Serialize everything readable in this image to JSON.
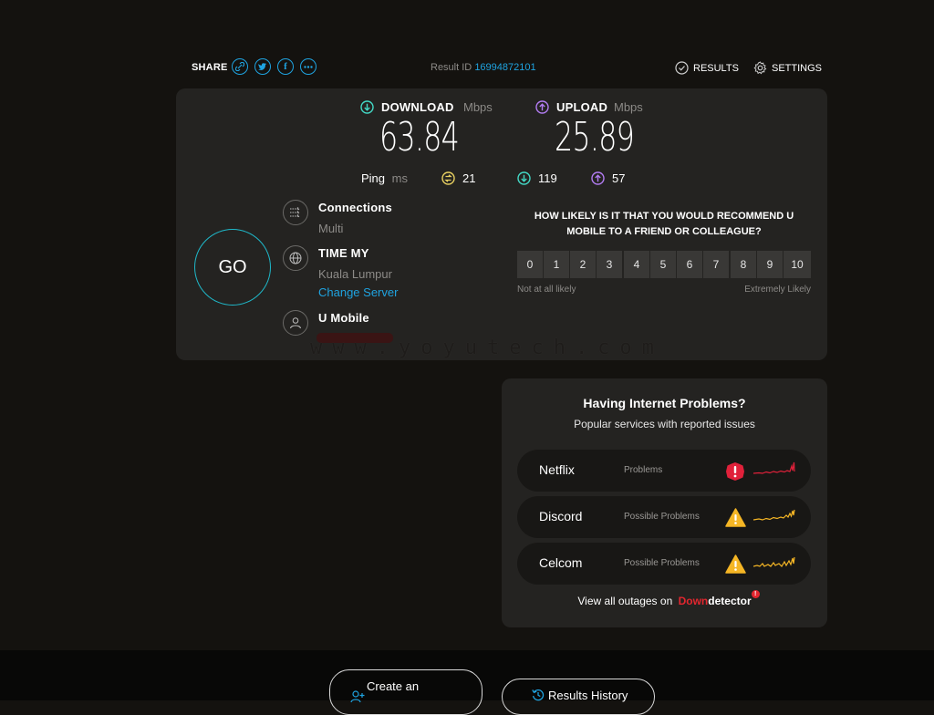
{
  "header": {
    "share_label": "SHARE",
    "share_icons": [
      "link-icon",
      "twitter-icon",
      "facebook-icon",
      "more-icon"
    ],
    "result_id_label": "Result ID",
    "result_id_value": "16994872101",
    "results_label": "RESULTS",
    "settings_label": "SETTINGS"
  },
  "speeds": {
    "download_label": "DOWNLOAD",
    "download_unit": "Mbps",
    "download_value": "63.84",
    "upload_label": "UPLOAD",
    "upload_unit": "Mbps",
    "upload_value": "25.89"
  },
  "ping": {
    "label": "Ping",
    "unit": "ms",
    "idle": "21",
    "download": "119",
    "upload": "57"
  },
  "go_label": "GO",
  "server": {
    "connections_label": "Connections",
    "connections_value": "Multi",
    "host_name": "TIME MY",
    "host_location": "Kuala Lumpur",
    "change_server": "Change Server",
    "isp_name": "U Mobile"
  },
  "watermark": "www.yoyutech.com",
  "survey": {
    "question": "HOW LIKELY IS IT THAT YOU WOULD RECOMMEND U MOBILE TO A FRIEND OR COLLEAGUE?",
    "options": [
      "0",
      "1",
      "2",
      "3",
      "4",
      "5",
      "6",
      "7",
      "8",
      "9",
      "10"
    ],
    "low_label": "Not at all likely",
    "high_label": "Extremely Likely"
  },
  "outages": {
    "title": "Having Internet Problems?",
    "subtitle": "Popular services with reported issues",
    "services": [
      {
        "name": "Netflix",
        "status": "Problems",
        "level": "problems"
      },
      {
        "name": "Discord",
        "status": "Possible Problems",
        "level": "possible"
      },
      {
        "name": "Celcom",
        "status": "Possible Problems",
        "level": "possible"
      }
    ],
    "view_all_prefix": "View all outages on",
    "brand_down": "Down",
    "brand_detector": "detector"
  },
  "footer": {
    "create_account_label": "Create an",
    "results_history_label": "Results History"
  },
  "colors": {
    "accent_blue": "#1fa3e0",
    "download_teal": "#43d9c6",
    "upload_purple": "#b27cf2",
    "ping_yellow": "#e8d061",
    "problem_red": "#e0213a",
    "warning_amber": "#f5b625",
    "brand_red": "#e3262f"
  }
}
